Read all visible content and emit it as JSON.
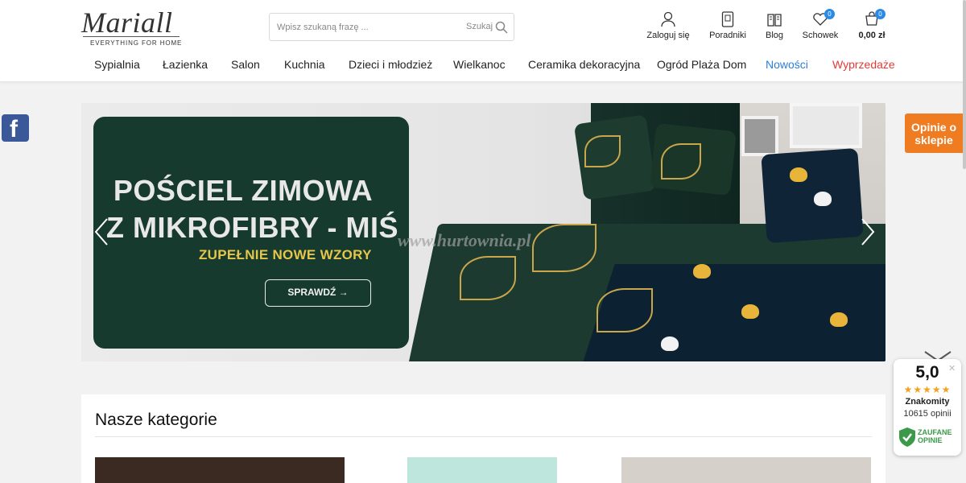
{
  "header": {
    "logo_text": "Mariall",
    "logo_tagline": "EVERYTHING FOR HOME",
    "search": {
      "placeholder": "Wpisz szukaną frazę ...",
      "button_label": "Szukaj"
    },
    "icons": [
      {
        "label": "Zaloguj się",
        "icon": "user-icon"
      },
      {
        "label": "Poradniki",
        "icon": "guide-book-icon"
      },
      {
        "label": "Blog",
        "icon": "blog-book-icon"
      },
      {
        "label": "Schowek",
        "icon": "heart-icon",
        "badge": "0"
      },
      {
        "label": "0,00 zł",
        "icon": "cart-icon",
        "badge": "0"
      }
    ]
  },
  "nav": [
    {
      "label": "Sypialnia"
    },
    {
      "label": "Łazienka"
    },
    {
      "label": "Salon"
    },
    {
      "label": "Kuchnia"
    },
    {
      "label": "Dzieci i młodzież"
    },
    {
      "label": "Wielkanoc"
    },
    {
      "label": "Ceramika dekoracyjna"
    },
    {
      "label": "Ogród Plaża Dom"
    },
    {
      "label": "Nowości",
      "color": "#2a7fd8"
    },
    {
      "label": "Wyprzedaże",
      "color": "#e53935"
    }
  ],
  "hero": {
    "line1": "POŚCIEL ZIMOWA",
    "line2": "Z MIKROFIBRY - MIŚ",
    "subtitle": "ZUPEŁNIE NOWE WZORY",
    "button": "SPRAWDŹ →",
    "watermark": "www.hurtownia.pl"
  },
  "side": {
    "facebook": "f",
    "opinie": "Opinie o sklepie"
  },
  "categories": {
    "title": "Nasze kategorie"
  },
  "trust_widget": {
    "score": "5,0",
    "stars": "★★★★★",
    "rating_word": "Znakomity",
    "reviews": "10615 opinii",
    "brand_line1": "ZAUFANE",
    "brand_line2": "OPINIE"
  },
  "colors": {
    "accent_blue": "#2a7fd8",
    "sale_red": "#e53935",
    "badge_blue": "#2a8be6",
    "opinie_orange": "#f07c22",
    "hero_panel": "#163a2d"
  }
}
